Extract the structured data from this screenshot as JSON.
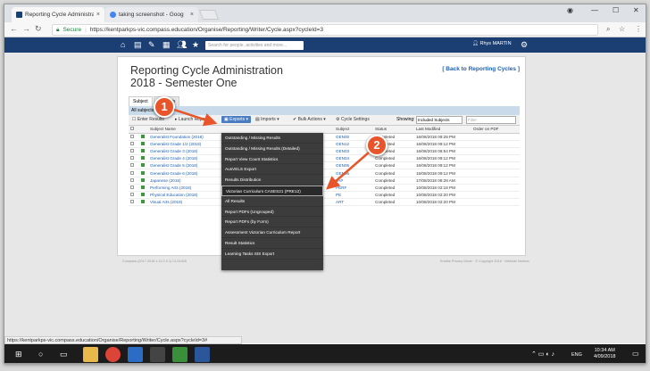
{
  "browser": {
    "tabs": [
      {
        "title": "Reporting Cycle Administra",
        "close": "×"
      },
      {
        "title": "taking screenshot - Goog",
        "close": "×"
      }
    ],
    "url_secure_label": "Secure",
    "url": "https://kentparkps-vic.compass.education/Organise/Reporting/Writer/Cycle.aspx?cycleId=3"
  },
  "topnav": {
    "search_placeholder": "Search for people, activities and more...",
    "user_name": "Rhys MARTIN"
  },
  "page": {
    "title_line1": "Reporting Cycle Administration",
    "title_line2": "2018 - Semester One",
    "back_link": "[ Back to Reporting Cycles ]",
    "tabs": [
      "Subject",
      "Students"
    ],
    "sub_header": "All subjects",
    "toolbar": {
      "enter_results": "Enter Results",
      "launch": "Launch Reports",
      "exports": "Exports ▾",
      "imports": "Imports ▾",
      "bulk_actions": "Bulk Actions ▾",
      "cycle_settings": "Cycle Settings",
      "showing_label": "Showing:",
      "showing_value": "Included Subjects",
      "filter_placeholder": "Filter"
    },
    "table": {
      "headers": [
        "Subject Name",
        "Subject",
        "Status",
        "Last Modified",
        "Order on PDF"
      ],
      "rows": [
        {
          "name": "Generalist Foundation (2018)",
          "code": "GEN00",
          "status": "Completed",
          "modified": "16/08/2018 09:28 PM"
        },
        {
          "name": "Generalist Grade 1/2 (2018)",
          "code": "GEN12",
          "status": "Completed",
          "modified": "16/08/2018 09:12 PM"
        },
        {
          "name": "Generalist Grade 3 (2018)",
          "code": "GEN03",
          "status": "Completed",
          "modified": "16/08/2018 06:54 PM"
        },
        {
          "name": "Generalist Grade 4 (2018)",
          "code": "GEN04",
          "status": "Completed",
          "modified": "16/08/2018 09:12 PM"
        },
        {
          "name": "Generalist Grade 5 (2018)",
          "code": "GEN05",
          "status": "Completed",
          "modified": "16/08/2018 09:12 PM"
        },
        {
          "name": "Generalist Grade 6 (2018)",
          "code": "GEN06",
          "status": "Completed",
          "modified": "16/08/2018 09:12 PM"
        },
        {
          "name": "Japanese (2018)",
          "code": "JAP",
          "status": "Completed",
          "modified": "17/08/2018 08:28 AM"
        },
        {
          "name": "Performing Arts (2018)",
          "code": "PERF",
          "status": "Completed",
          "modified": "10/08/2018 02:18 PM"
        },
        {
          "name": "Physical Education (2018)",
          "code": "PE",
          "status": "Completed",
          "modified": "10/08/2018 02:20 PM"
        },
        {
          "name": "Visual Arts (2018)",
          "code": "ART",
          "status": "Completed",
          "modified": "10/08/2018 02:20 PM"
        }
      ]
    },
    "footer_left": "Compass (2017.2018.1.11.0.0.1) CLOUD8",
    "footer_right": "Enable Privacy Mode  ·  © Copyright 2018  ·  Website Notices"
  },
  "exports_menu": [
    "Outstanding / Missing Results",
    "Outstanding / Missing Results (Detailed)",
    "Report View Count Statistics",
    "AusVELS Export",
    "Results Distribution",
    "Victorian Curriculum CASES21 (PRE12)",
    "All Results",
    "Report PDFs (Ungrouped)",
    "Report PDFs (by Form)",
    "Assessment Victorian Curriculum Report",
    "Result Statistics",
    "Learning Tasks SIS Export"
  ],
  "callouts": [
    "1",
    "2"
  ],
  "status_url": "https://kentparkps-vic.compass.education/Organise/Reporting/Writer/Cycle.aspx?cycleId=3#",
  "taskbar": {
    "lang": "ENG",
    "time": "10:34 AM",
    "date": "4/09/2018"
  },
  "colors": {
    "accent": "#1c3f73",
    "callout": "#e8552a",
    "link": "#2060b0"
  }
}
